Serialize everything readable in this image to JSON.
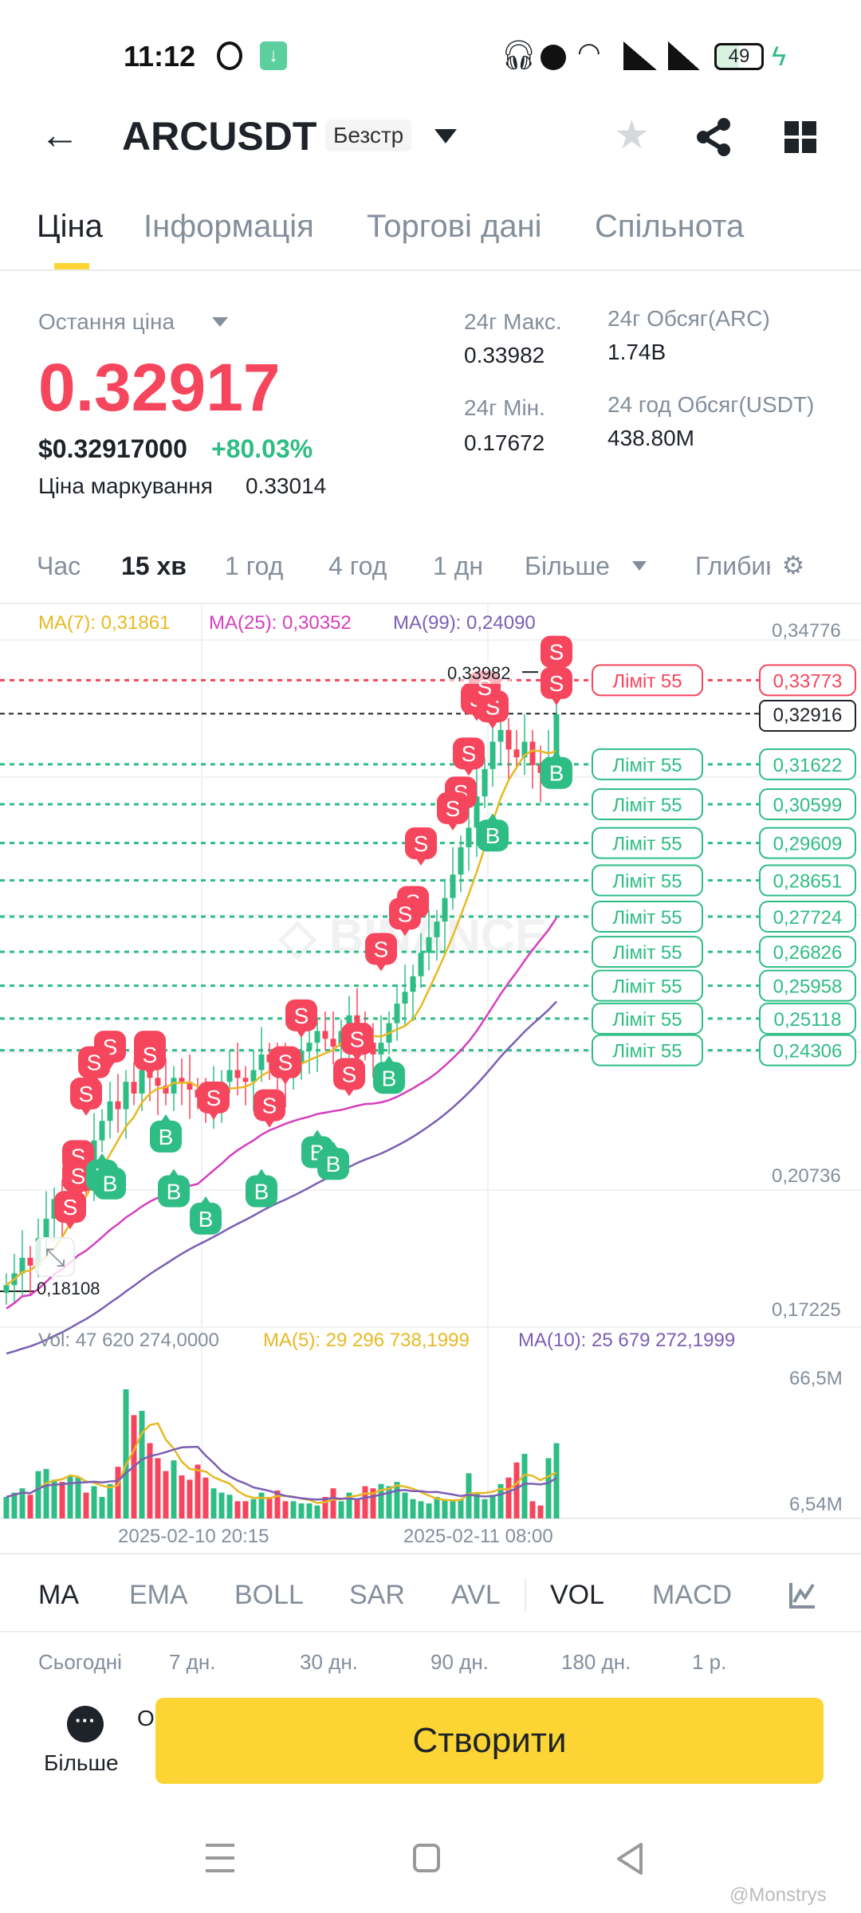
{
  "status_bar": {
    "time": "11:12",
    "battery": "49"
  },
  "header": {
    "symbol": "ARCUSDT",
    "badge": "Безстр"
  },
  "tabs": [
    {
      "label": "Ціна",
      "active": true
    },
    {
      "label": "Інформація"
    },
    {
      "label": "Торгові дані"
    },
    {
      "label": "Спільнота"
    }
  ],
  "price": {
    "last_label": "Остання ціна",
    "last": "0.32917",
    "usd": "$0.32917000",
    "change": "+80.03%",
    "mark_label": "Ціна маркування",
    "mark": "0.33014"
  },
  "stats": {
    "high_label": "24г Макс.",
    "high": "0.33982",
    "low_label": "24г Мін.",
    "low": "0.17672",
    "vol_arc_label": "24г Обсяг(ARC)",
    "vol_arc": "1.74B",
    "vol_usdt_label": "24 год Обсяг(USDT)",
    "vol_usdt": "438.80M"
  },
  "intervals": [
    {
      "label": "Час"
    },
    {
      "label": "15 хв",
      "active": true
    },
    {
      "label": "1 год"
    },
    {
      "label": "4 год"
    },
    {
      "label": "1 дн"
    },
    {
      "label": "Більше"
    },
    {
      "label": "Глибина"
    }
  ],
  "colors": {
    "up": "#2ebd85",
    "down": "#f6465d",
    "ma7": "#e8b923",
    "ma25": "#d63fbf",
    "ma99": "#7b5fb5",
    "accent": "#fcd535"
  },
  "chart_data": {
    "type": "candlestick",
    "ma_legend": {
      "ma7": "MA(7): 0,31861",
      "ma25": "MA(25): 0,30352",
      "ma99": "MA(99): 0,24090"
    },
    "y_ticks": [
      "0,34776",
      "0,20736",
      "0,17225"
    ],
    "y_range": [
      0.17225,
      0.34776
    ],
    "high_marker": "0,33982",
    "low_marker": "0,18108",
    "current_price": "0,32916",
    "closes": [
      0.183,
      0.186,
      0.19,
      0.188,
      0.195,
      0.2,
      0.205,
      0.203,
      0.21,
      0.215,
      0.212,
      0.22,
      0.225,
      0.23,
      0.228,
      0.235,
      0.232,
      0.238,
      0.236,
      0.234,
      0.232,
      0.236,
      0.235,
      0.233,
      0.231,
      0.229,
      0.232,
      0.235,
      0.238,
      0.236,
      0.235,
      0.238,
      0.242,
      0.24,
      0.238,
      0.236,
      0.24,
      0.243,
      0.245,
      0.248,
      0.246,
      0.244,
      0.248,
      0.252,
      0.25,
      0.245,
      0.242,
      0.245,
      0.25,
      0.255,
      0.258,
      0.262,
      0.268,
      0.272,
      0.276,
      0.282,
      0.288,
      0.295,
      0.3,
      0.308,
      0.315,
      0.322,
      0.325,
      0.32,
      0.318,
      0.322,
      0.316,
      0.314,
      0.318,
      0.329
    ],
    "volumes_m": [
      10,
      12,
      14,
      11,
      22,
      23,
      18,
      17,
      20,
      19,
      12,
      15,
      10,
      16,
      24,
      60,
      48,
      50,
      35,
      28,
      22,
      27,
      20,
      18,
      25,
      19,
      14,
      12,
      11,
      8,
      8,
      9,
      12,
      10,
      13,
      8,
      8,
      7,
      7,
      6,
      10,
      14,
      8,
      12,
      9,
      15,
      14,
      16,
      15,
      17,
      12,
      9,
      8,
      7,
      10,
      9,
      8,
      9,
      21,
      12,
      9,
      11,
      16,
      19,
      26,
      30,
      8,
      6,
      28,
      35
    ],
    "vol_legend": {
      "vol": "Vol: 47 620 274,0000",
      "ma5": "MA(5): 29 296 738,1999",
      "ma10": "MA(10): 25 679 272,1999"
    },
    "vol_ticks": [
      "66,5M",
      "6,54M"
    ],
    "x_ticks": [
      "2025-02-10 20:15",
      "2025-02-11 08:00"
    ],
    "markers": [
      {
        "i": 69,
        "t": "S",
        "p": 0.345
      },
      {
        "i": 69,
        "t": "S",
        "p": 0.337
      },
      {
        "i": 59,
        "t": "S",
        "p": 0.333
      },
      {
        "i": 61,
        "t": "S",
        "p": 0.331
      },
      {
        "i": 60,
        "t": "S",
        "p": 0.336
      },
      {
        "i": 58,
        "t": "S",
        "p": 0.319
      },
      {
        "i": 57,
        "t": "S",
        "p": 0.309
      },
      {
        "i": 56,
        "t": "S",
        "p": 0.305
      },
      {
        "i": 52,
        "t": "S",
        "p": 0.296
      },
      {
        "i": 51,
        "t": "S",
        "p": 0.281
      },
      {
        "i": 50,
        "t": "S",
        "p": 0.278
      },
      {
        "i": 47,
        "t": "S",
        "p": 0.269
      },
      {
        "i": 37,
        "t": "S",
        "p": 0.252
      },
      {
        "i": 44,
        "t": "S",
        "p": 0.246
      },
      {
        "i": 35,
        "t": "S",
        "p": 0.24
      },
      {
        "i": 43,
        "t": "S",
        "p": 0.237
      },
      {
        "i": 33,
        "t": "S",
        "p": 0.229
      },
      {
        "i": 26,
        "t": "S",
        "p": 0.231
      },
      {
        "i": 18,
        "t": "S",
        "p": 0.244
      },
      {
        "i": 13,
        "t": "S",
        "p": 0.244
      },
      {
        "i": 11,
        "t": "S",
        "p": 0.24
      },
      {
        "i": 18,
        "t": "S",
        "p": 0.242
      },
      {
        "i": 10,
        "t": "S",
        "p": 0.232
      },
      {
        "i": 9,
        "t": "S",
        "p": 0.216
      },
      {
        "i": 9,
        "t": "S",
        "p": 0.211
      },
      {
        "i": 8,
        "t": "S",
        "p": 0.203
      },
      {
        "i": 69,
        "t": "B",
        "p": 0.314
      },
      {
        "i": 61,
        "t": "B",
        "p": 0.298
      },
      {
        "i": 48,
        "t": "B",
        "p": 0.236
      },
      {
        "i": 20,
        "t": "B",
        "p": 0.221
      },
      {
        "i": 12,
        "t": "B",
        "p": 0.211
      },
      {
        "i": 13,
        "t": "B",
        "p": 0.209
      },
      {
        "i": 21,
        "t": "B",
        "p": 0.207
      },
      {
        "i": 25,
        "t": "B",
        "p": 0.2
      },
      {
        "i": 32,
        "t": "B",
        "p": 0.207
      },
      {
        "i": 39,
        "t": "B",
        "p": 0.217
      },
      {
        "i": 41,
        "t": "B",
        "p": 0.214
      }
    ],
    "limit_orders": [
      {
        "side": "sell",
        "label": "Ліміт  55",
        "price": 0.33773,
        "price_label": "0,33773"
      },
      {
        "side": "buy",
        "label": "Ліміт  55",
        "price": 0.31622,
        "price_label": "0,31622"
      },
      {
        "side": "buy",
        "label": "Ліміт  55",
        "price": 0.30599,
        "price_label": "0,30599"
      },
      {
        "side": "buy",
        "label": "Ліміт  55",
        "price": 0.29609,
        "price_label": "0,29609"
      },
      {
        "side": "buy",
        "label": "Ліміт  55",
        "price": 0.28651,
        "price_label": "0,28651"
      },
      {
        "side": "buy",
        "label": "Ліміт  55",
        "price": 0.27724,
        "price_label": "0,27724"
      },
      {
        "side": "buy",
        "label": "Ліміт  55",
        "price": 0.26826,
        "price_label": "0,26826"
      },
      {
        "side": "buy",
        "label": "Ліміт  55",
        "price": 0.25958,
        "price_label": "0,25958"
      },
      {
        "side": "buy",
        "label": "Ліміт  55",
        "price": 0.25118,
        "price_label": "0,25118"
      },
      {
        "side": "buy",
        "label": "Ліміт  55",
        "price": 0.24306,
        "price_label": "0,24306"
      }
    ]
  },
  "indicators": [
    {
      "label": "MA",
      "active": true
    },
    {
      "label": "EMA"
    },
    {
      "label": "BOLL"
    },
    {
      "label": "SAR"
    },
    {
      "label": "AVL"
    },
    {
      "label": "VOL",
      "active": true
    },
    {
      "label": "MACD"
    }
  ],
  "ranges": [
    "Сьогодні",
    "7 дн.",
    "30 дн.",
    "90 дн.",
    "180 дн.",
    "1 р."
  ],
  "bottom": {
    "more_label": "Більше",
    "partial": "О",
    "create_label": "Створити"
  },
  "watermark": "@Monstrys"
}
